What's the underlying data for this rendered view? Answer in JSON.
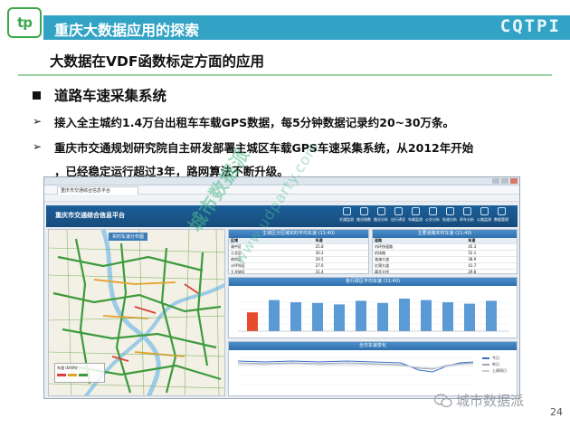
{
  "header": {
    "title": "重庆大数据应用的探索",
    "brand": "CQTPI"
  },
  "subtitle": "大数据在VDF函数标定方面的应用",
  "section": {
    "heading": "道路车速采集系统",
    "items": [
      "接入全主城约1.4万台出租车车载GPS数据，每5分钟数据记录约20~30万条。",
      "重庆市交通规划研究院自主研发部署主城区车载GPS车速采集系统，从2012年开始",
      "，已经稳定运行超过3年，路网算法不断升级。"
    ]
  },
  "app": {
    "tab_label": "重庆市交通综合信息平台",
    "name": "重庆市交通综合信息平台",
    "nav": [
      "交通监测",
      "路况指数",
      "路况分析",
      "出行诱导",
      "车辆监测",
      "公交分析",
      "轨道分析",
      "停车分析",
      "公路监测",
      "数据管理"
    ],
    "map_label": "实时车速分布图",
    "legend_title": "车速 (km/h)",
    "table1": {
      "title": "主城区分区域实时平均车速 (11:40)",
      "rows": [
        [
          "区域",
          "车速"
        ],
        [
          "渝中区",
          "25.8"
        ],
        [
          "江北区",
          "30.2"
        ],
        [
          "南岸区",
          "29.5"
        ],
        [
          "沙坪坝区",
          "27.6"
        ],
        [
          "九龙坡区",
          "31.4"
        ]
      ]
    },
    "table2": {
      "title": "主要道路实时车速 (11:40)",
      "rows": [
        [
          "道路",
          "车速"
        ],
        [
          "内环快速路",
          "45.3"
        ],
        [
          "机场路",
          "52.1"
        ],
        [
          "渝澳大道",
          "38.9"
        ],
        [
          "红锦大道",
          "41.7"
        ],
        [
          "嘉华大桥",
          "29.8"
        ]
      ]
    },
    "bar_chart": {
      "title": "各行政区平均车速 (11:40)",
      "values": [
        26,
        43,
        40,
        39,
        37,
        42,
        39,
        45,
        43,
        40,
        38,
        42
      ]
    },
    "line_chart": {
      "title": "全日车速变化",
      "legend": [
        "今日",
        "昨日",
        "上周同日"
      ]
    }
  },
  "watermark": {
    "text1": "城市数据派",
    "text2": "www.udparty.com"
  },
  "footer": {
    "wechat": "城市数据派",
    "page": "24"
  },
  "colors": {
    "title_bar": "#33a3c5",
    "accent_green": "#3aa84a",
    "app_blue": "#1c5f9a",
    "bar_blue": "#5b9bd5",
    "bar_red": "#e84b2b"
  }
}
